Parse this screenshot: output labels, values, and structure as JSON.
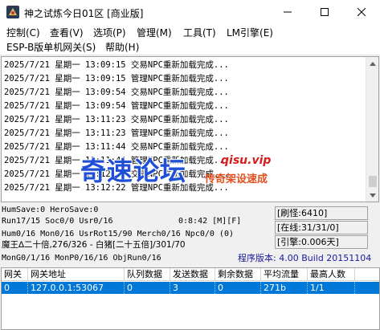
{
  "window": {
    "title": "神之试炼今日01区 [商业版]"
  },
  "menu": {
    "items": [
      "控制(C)",
      "查看(V)",
      "选项(P)",
      "管理(M)",
      "工具(T)",
      "LM引擎(E)",
      "ESP-B版单机网关(S)",
      "帮助(H)"
    ]
  },
  "log": {
    "lines": [
      "2025/7/21 星期一 13:09:15 交易NPC重新加载完成...",
      "2025/7/21 星期一 13:09:15 管理NPC重新加载完成...",
      "2025/7/21 星期一 13:09:54 交易NPC重新加载完成...",
      "2025/7/21 星期一 13:09:54 管理NPC重新加载完成...",
      "2025/7/21 星期一 13:11:23 交易NPC重新加载完成...",
      "2025/7/21 星期一 13:11:23 管理NPC重新加载完成...",
      "2025/7/21 星期一 13:11:44 交易NPC重新加载完成...",
      "2025/7/21 星期一 13:11:44 管理NPC重新加载完成...",
      "2025/7/21 星期一 13:12:22 交易NPC重新加载完成...",
      "2025/7/21 星期一 13:12:22 管理NPC重新加载完成..."
    ]
  },
  "watermark": {
    "brand": "奇速论坛",
    "url": "qisu.vip",
    "slogan": "传奇架设速成"
  },
  "status": {
    "line1": "HumSave:0 HeroSave:0",
    "line2": "Run17/15 Soc0/0 Usr0/16",
    "time": "0:8:42 [M][F]",
    "line3": "Hum0/16 Mon0/16 UsrRot15/90 Merch0/16 Npc0/0 (0)",
    "line4": "魔王∆二十倍,276/326 - 白猪[二十五倍]/301/70",
    "line5": "MonG0/1/16 MonP0/16/16 ObjRun0/16",
    "refresh": "[刷怪:6410]",
    "online": "[在线:31/31/0]",
    "engine": "[引擎:0.006天]",
    "version": "程序版本: 4.00 Build 20151104"
  },
  "gateway_table": {
    "columns": [
      "网关",
      "网关地址",
      "队列数据",
      "发送数据",
      "剩余数据",
      "平均流量",
      "最高人数"
    ],
    "rows": [
      [
        "0",
        "127.0.0.1:53067",
        "0",
        "3",
        "0",
        "271b",
        "1/1"
      ]
    ]
  }
}
